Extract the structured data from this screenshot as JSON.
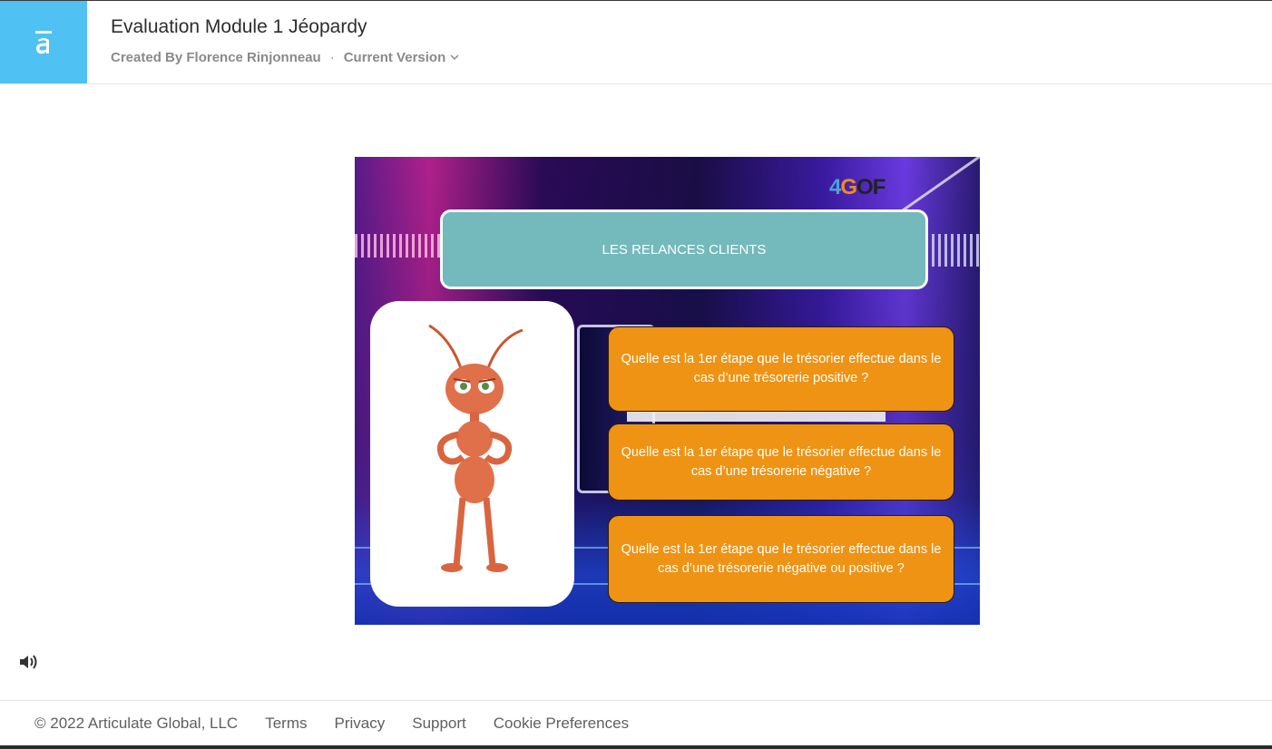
{
  "header": {
    "title": "Evaluation Module 1 Jéopardy",
    "created_by": "Created By Florence Rinjonneau",
    "separator": "·",
    "version_label": "Current Version"
  },
  "slide": {
    "brand": {
      "part1": "4",
      "part2": "G",
      "part3": "OF"
    },
    "topic": "LES RELANCES CLIENTS",
    "answers": [
      "Quelle est la 1er étape que le trésorier effectue dans le cas d’une trésorerie positive ?",
      "Quelle est la 1er étape que le trésorier effectue dans le cas d’une trésorerie négative ?",
      "Quelle est la 1er étape que le trésorier effectue dans le cas d’une trésorerie négative ou positive ?"
    ],
    "colors": {
      "topic_bg": "#74b9bb",
      "answer_bg": "#ee9313",
      "logo_bg": "#4fc1f3"
    }
  },
  "icons": {
    "logo": "articulate-a-icon",
    "audio": "speaker-icon",
    "chevron": "chevron-down-icon"
  },
  "footer": {
    "copyright": "© 2022 Articulate Global, LLC",
    "links": [
      "Terms",
      "Privacy",
      "Support",
      "Cookie Preferences"
    ]
  }
}
